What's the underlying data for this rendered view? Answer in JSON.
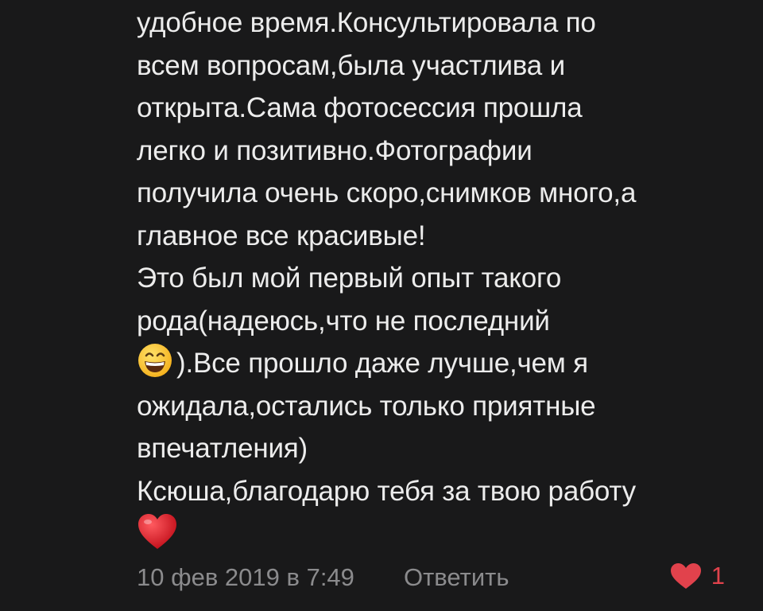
{
  "comment": {
    "lines": [
      "удобное время.Консультировала по",
      "всем вопросам,была участлива и",
      "открыта.Сама фотосессия прошла",
      "легко и позитивно.Фотографии",
      "получила очень скоро,снимков много,а",
      "главное все красивые!",
      "Это был мой первый опыт такого",
      "рода(надеюсь,что не последний"
    ],
    "line_after_emoji": ").Все прошло даже лучше,чем я",
    "lines_2": [
      "ожидала,остались только приятные",
      "впечатления)",
      "Ксюша,благодарю тебя за твою работу"
    ],
    "emoji_1": "grinning-face-emoji",
    "emoji_2": "red-heart-emoji"
  },
  "meta": {
    "date": "10 фев 2019 в 7:49",
    "reply_label": "Ответить",
    "likes_count": "1",
    "like_icon": "heart-icon"
  },
  "colors": {
    "background": "#19191a",
    "text": "#ececec",
    "secondary": "#8b8b8d",
    "like": "#e1424c"
  }
}
